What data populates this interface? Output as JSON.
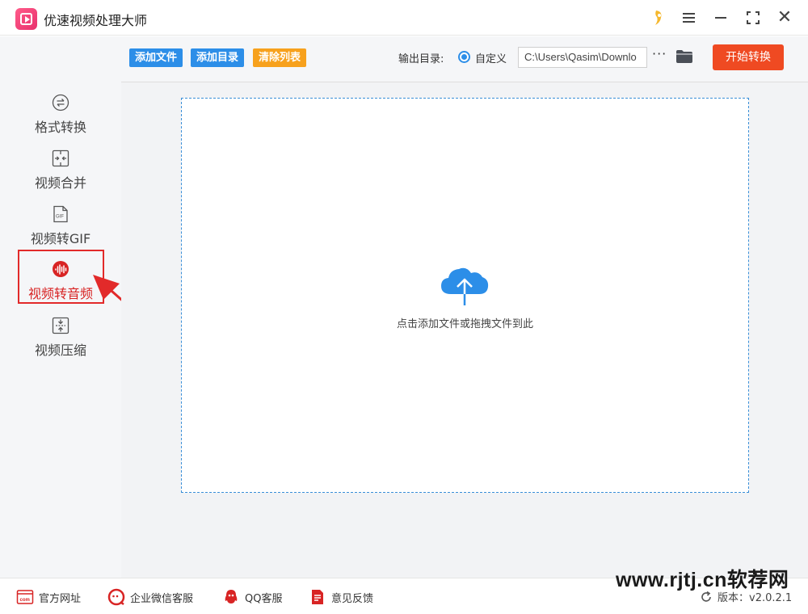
{
  "window": {
    "title": "优速视频处理大师"
  },
  "sidebar": {
    "items": [
      {
        "label": "格式转换",
        "icon": "format-convert-icon"
      },
      {
        "label": "视频合并",
        "icon": "merge-icon"
      },
      {
        "label": "视频转GIF",
        "icon": "gif-icon"
      },
      {
        "label": "视频转音频",
        "icon": "audio-icon"
      },
      {
        "label": "视频压缩",
        "icon": "compress-icon"
      }
    ],
    "active_index": 3
  },
  "toolbar": {
    "add_file": "添加文件",
    "add_folder": "添加目录",
    "clear_list": "清除列表",
    "output_label": "输出目录:",
    "custom_label": "自定义",
    "output_path": "C:\\Users\\Qasim\\Downlo",
    "more": "···",
    "start": "开始转换"
  },
  "main": {
    "drop_hint": "点击添加文件或拖拽文件到此"
  },
  "footer": {
    "website": "官方网址",
    "wechat": "企业微信客服",
    "qq": "QQ客服",
    "feedback": "意见反馈",
    "version": "版本：v2.0.2.1"
  },
  "watermark": "www.rjtj.cn软荐网",
  "colors": {
    "accent_blue": "#2c8ee8",
    "accent_orange": "#f7a11d",
    "start_red": "#ef4a22",
    "highlight_red": "#e22a2a"
  }
}
